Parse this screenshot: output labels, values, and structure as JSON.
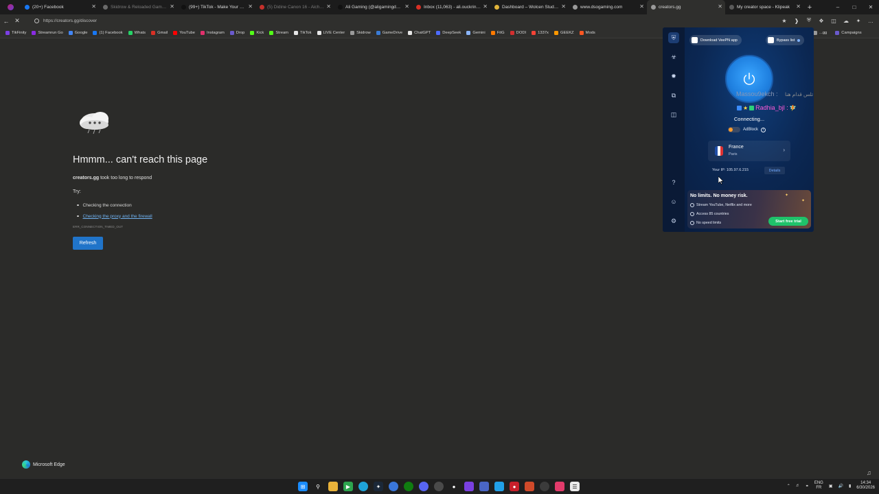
{
  "tabs": [
    {
      "label": "(20+) Facebook",
      "color": "#1877f2",
      "dim": false
    },
    {
      "label": "Skidrow & Reloaded Games – F",
      "color": "#6a6a6a",
      "dim": true
    },
    {
      "label": "(99+) TikTok - Make Your Day",
      "color": "#111111",
      "dim": false
    },
    {
      "label": "(5) Didine Canon 16 - Aicha La",
      "color": "#c4302b",
      "dim": true
    },
    {
      "label": "Ali Gaming (@aligamingdz16) |",
      "color": "#111111",
      "dim": false
    },
    {
      "label": "Inbox (11,063) - ali.ouckrine253",
      "color": "#d93025",
      "dim": false
    },
    {
      "label": "Dashboard – Wolcen Studio Co",
      "color": "#e0b43a",
      "dim": false
    },
    {
      "label": "www.dsogaming.com",
      "color": "#9a9a9a",
      "dim": false
    },
    {
      "label": "creators.gg",
      "color": "#9a9a9a",
      "dim": false,
      "active": true
    },
    {
      "label": "My creator space - Klipeak",
      "color": "#5a5a5a",
      "dim": false
    }
  ],
  "address": {
    "url": "https://creators.gg/discover"
  },
  "favorites": [
    {
      "label": "TikFinity",
      "color": "#7b3fe4"
    },
    {
      "label": "Streamrun Go",
      "color": "#8a2be2"
    },
    {
      "label": "Google",
      "color": "#4285f4"
    },
    {
      "label": "(1) Facebook",
      "color": "#1877f2"
    },
    {
      "label": "Whats",
      "color": "#25d366"
    },
    {
      "label": "Gmail",
      "color": "#d93025"
    },
    {
      "label": "YouTube",
      "color": "#ff0000"
    },
    {
      "label": "Instagram",
      "color": "#e1306c"
    },
    {
      "label": "Drop",
      "color": "#6a5acd"
    },
    {
      "label": "Kick",
      "color": "#53fc18"
    },
    {
      "label": "Stream",
      "color": "#53fc18"
    },
    {
      "label": "TikTok",
      "color": "#e6e6e6"
    },
    {
      "label": "LIVE Center",
      "color": "#e6e6e6"
    },
    {
      "label": "Skidrow",
      "color": "#9a9a9a"
    },
    {
      "label": "GameDrive",
      "color": "#3a7bd5"
    },
    {
      "label": "ChatGPT",
      "color": "#e6e6e6"
    },
    {
      "label": "DeepSeek",
      "color": "#4d6bfe"
    },
    {
      "label": "Gemini",
      "color": "#8ab4f8"
    },
    {
      "label": "FitG",
      "color": "#ff7a00"
    },
    {
      "label": "DODI",
      "color": "#d32f2f"
    },
    {
      "label": "1337x",
      "color": "#f44336"
    },
    {
      "label": "GEEKZ",
      "color": "#ff9800"
    },
    {
      "label": "Mods",
      "color": "#ff5722"
    }
  ],
  "favorites_overflow": [
    {
      "label": "...gg",
      "color": "#9a9a9a"
    },
    {
      "label": "Campaigns",
      "color": "#6a5acd"
    }
  ],
  "error": {
    "title": "Hmmm... can't reach this page",
    "host": "creators.gg",
    "message": " took too long to respond",
    "try_label": "Try:",
    "suggestions": [
      {
        "text": "Checking the connection",
        "link": false
      },
      {
        "text": "Checking the proxy and the firewall",
        "link": true
      }
    ],
    "code": "ERR_CONNECTION_TIMED_OUT",
    "refresh_label": "Refresh"
  },
  "edge_brand": "Microsoft Edge",
  "vpn": {
    "download_label": "Download VeePN app",
    "bypass_label": "Bypass list",
    "status": "Connecting...",
    "adblock_label": "AdBlock",
    "country": "France",
    "city": "Paris",
    "ip_label": "Your IP: 105.97.6.215",
    "details_label": "Details",
    "promo_title": "No limits. No money risk.",
    "promo_features": [
      "Stream YouTube, Netflix and more",
      "Access 85 countries",
      "No speed limits"
    ],
    "trial_label": "Start free trial"
  },
  "chat_overlay": {
    "line1_name": "Massou9ekch :",
    "line1_text": "كاش تلس قدام هنا",
    "line2_name": "Radhia_bjl :"
  },
  "taskbar": {
    "lang_top": "ENG",
    "lang_bottom": "FR",
    "time": "14:34",
    "date": "6/30/2026"
  }
}
